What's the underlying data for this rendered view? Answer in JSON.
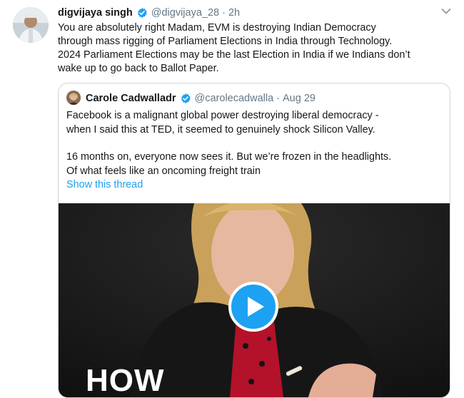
{
  "author": {
    "name": "digvijaya singh",
    "handle": "@digvijaya_28",
    "separator": "·",
    "time": "2h"
  },
  "tweet_text": [
    "You are absolutely right Madam, EVM is destroying Indian Democracy",
    "through mass rigging of Parliament Elections in India through Technology.",
    "2024 Parliament Elections may be the last Election in India if we Indians don’t",
    "wake up to go back to Ballot Paper."
  ],
  "quoted": {
    "name": "Carole Cadwalladr",
    "handle": "@carolecadwalla",
    "separator": "·",
    "date": "Aug 29",
    "text_lines_1": [
      "Facebook is a malignant global power destroying liberal democracy -",
      "when I said this at TED, it seemed to genuinely shock Silicon Valley."
    ],
    "text_lines_2": [
      "16 months on, everyone now sees it. But we’re frozen in the headlights.",
      "Of what feels like an oncoming freight train"
    ],
    "show_thread": "Show this thread",
    "video_overlay_text": "HOW"
  },
  "icons": {
    "verified": "verified-badge-icon",
    "menu": "chevron-down-icon",
    "play": "play-icon"
  },
  "colors": {
    "link": "#1da1f2",
    "secondary_text": "#657786",
    "border": "#ccd6dd",
    "play_button": "#1da1f2"
  }
}
